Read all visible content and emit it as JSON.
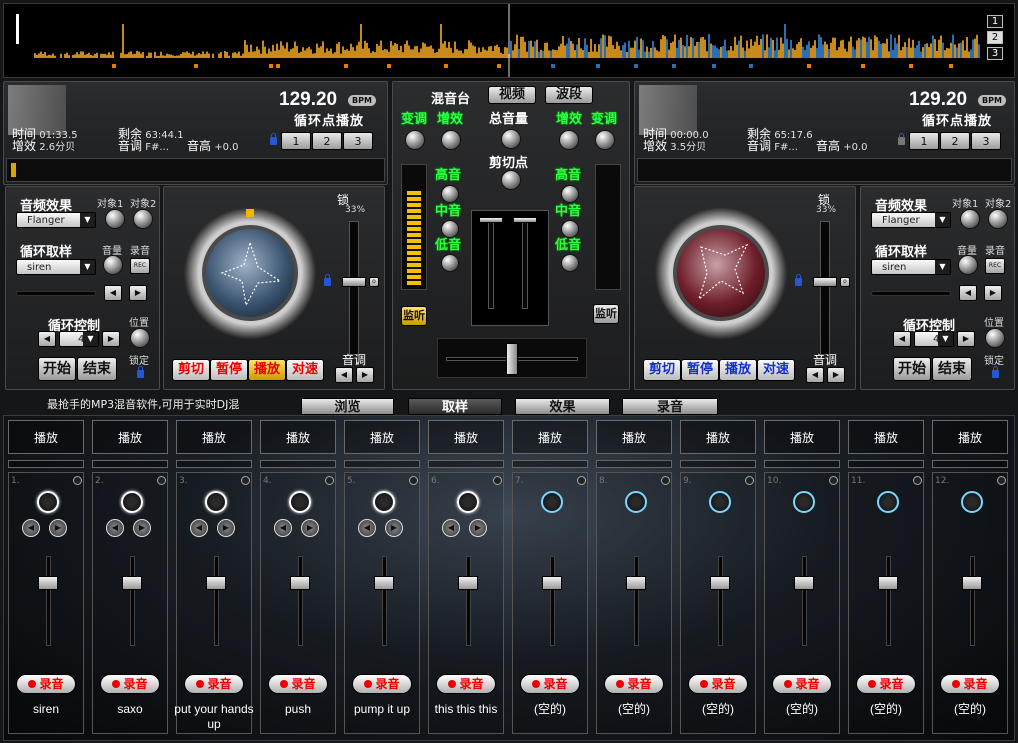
{
  "waveform": {
    "track_buttons": [
      "1",
      "2",
      "3"
    ],
    "colors": {
      "wave": "#c88a1a",
      "overlay": "#2a6fb0",
      "marker": "#e67e00"
    }
  },
  "deck_left": {
    "bpm": "129.20",
    "bpm_tag": "BPM",
    "loop_title": "循环点播放",
    "loop_buttons": [
      "1",
      "2",
      "3"
    ],
    "time_label": "时间",
    "time_value": "01:33.5",
    "remain_label": "剩余",
    "remain_value": "63:44.1",
    "gain_label": "增效",
    "gain_value": "2.6分贝",
    "key_label": "音调",
    "key_value": "F#...",
    "pitch_label": "音高",
    "pitch_value": "+0.0"
  },
  "deck_right": {
    "bpm": "129.20",
    "bpm_tag": "BPM",
    "loop_title": "循环点播放",
    "loop_buttons": [
      "1",
      "2",
      "3"
    ],
    "time_label": "时间",
    "time_value": "00:00.0",
    "remain_label": "剩余",
    "remain_value": "65:17.6",
    "gain_label": "增效",
    "gain_value": "3.5分贝",
    "key_label": "音调",
    "key_value": "F#...",
    "pitch_label": "音高",
    "pitch_value": "+0.0"
  },
  "effects_left": {
    "audio_fx": "音频效果",
    "obj1": "对象1",
    "obj2": "对象2",
    "fx_value": "Flanger",
    "loop_sample": "循环取样",
    "volume": "音量",
    "record": "录音",
    "sample_value": "siren",
    "rec_btn": "REC",
    "loop_ctrl": "循环控制",
    "position": "位置",
    "loop_value": "4",
    "lock": "锁定",
    "start": "开始",
    "end": "结束"
  },
  "effects_right": {
    "audio_fx": "音频效果",
    "obj1": "对象1",
    "obj2": "对象2",
    "fx_value": "Flanger",
    "loop_sample": "循环取样",
    "volume": "音量",
    "record": "录音",
    "sample_value": "siren",
    "rec_btn": "REC",
    "loop_ctrl": "循环控制",
    "position": "位置",
    "loop_value": "4",
    "lock": "锁定",
    "start": "开始",
    "end": "结束"
  },
  "turntable_left": {
    "lock": "锁",
    "pct": "33%",
    "pitch": "音调",
    "buttons": [
      "剪切",
      "暂停",
      "播放",
      "对速"
    ]
  },
  "turntable_right": {
    "lock": "锁",
    "pct": "33%",
    "pitch": "音调",
    "buttons": [
      "剪切",
      "暂停",
      "播放",
      "对速"
    ]
  },
  "mixer": {
    "tabs": [
      "混音台",
      "视频",
      "波段"
    ],
    "left": [
      "变调",
      "增效",
      "高音",
      "中音",
      "低音"
    ],
    "right": [
      "增效",
      "变调",
      "高音",
      "中音",
      "低音"
    ],
    "master": "总音量",
    "cut": "剪切点",
    "monitor": "监听"
  },
  "caption": "最抢手的MP3混音软件,可用于实时DJ混",
  "bottom_tabs": [
    "浏览",
    "取样",
    "效果",
    "录音"
  ],
  "sampler": {
    "play_label": "播放",
    "rec_label": "录音",
    "slots": [
      {
        "num": "1.",
        "name": "siren"
      },
      {
        "num": "2.",
        "name": "saxo"
      },
      {
        "num": "3.",
        "name": "put your hands up"
      },
      {
        "num": "4.",
        "name": "push"
      },
      {
        "num": "5.",
        "name": "pump it up"
      },
      {
        "num": "6.",
        "name": "this this this"
      },
      {
        "num": "7.",
        "name": "(空的)"
      },
      {
        "num": "8.",
        "name": "(空的)"
      },
      {
        "num": "9.",
        "name": "(空的)"
      },
      {
        "num": "10.",
        "name": "(空的)"
      },
      {
        "num": "11.",
        "name": "(空的)"
      },
      {
        "num": "12.",
        "name": "(空的)"
      }
    ]
  }
}
